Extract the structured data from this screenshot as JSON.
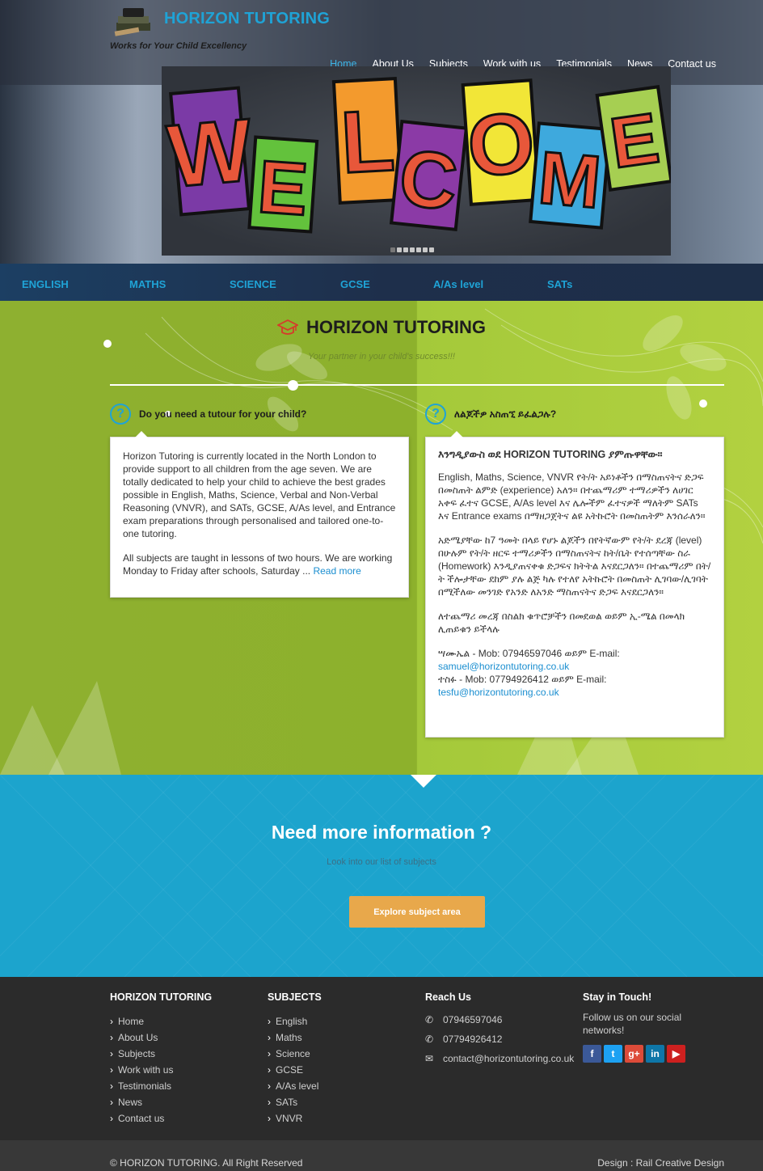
{
  "brand": {
    "name": "HORIZON TUTORING",
    "tagline": "Works for Your Child Excellency"
  },
  "nav": {
    "items": [
      "Home",
      "About Us",
      "Subjects",
      "Work with us",
      "Testimonials",
      "News",
      "Contact us"
    ],
    "active": "Home"
  },
  "slider": {
    "banner_letters": [
      "W",
      "E",
      "L",
      "C",
      "O",
      "M",
      "E"
    ],
    "slide_count": 7
  },
  "subject_bar": [
    "ENGLISH",
    "MATHS",
    "SCIENCE",
    "GCSE",
    "A/As level",
    "SATs"
  ],
  "intro": {
    "title": "HORIZON TUTORING",
    "subtitle": "Your partner in your child's success!!!"
  },
  "left_panel": {
    "question": "Do you need a tutour for your child?",
    "para1": "Horizon Tutoring is currently located in the North London to provide support to all children from the age seven. We are totally dedicated to help your child to achieve the best grades possible in English, Maths, Science, Verbal and Non-Verbal Reasoning (VNVR), and SATs, GCSE, A/As level, and Entrance exam preparations through personalised and tailored one-to-one tutoring.",
    "para2": "All subjects are taught in lessons of two hours. We are working Monday to Friday after schools, Saturday ...",
    "read_more": "Read more"
  },
  "right_panel": {
    "question": "ለልጆችዎ አስጠኚ ይፈልጋሉ?",
    "heading": "እንግዲያውስ ወደ HORIZON TUTORING ያምጡዋቸው።",
    "para1": "English, Maths, Science, VNVR የት/ት አይነቶችን በማስጠናትና ድጋፍ በመስጠት ልምድ (experience) አለን። በተጨማሪም ተማሪዎችን ለሀገር አቀፍ ፈተና GCSE, A/As level እና ሌሎችም ፈተናዎች ማለትም SATs እና Entrance exams በማዘጋጀትና ልዩ አትኩሮት በመስጠትም እንሰራለን።",
    "para2": "አድሜያቸው ከ7 ዓመት በላይ የሆኑ ልጆችን በየትኛውም የት/ት ደረጃ (level) በሁሉም የት/ት ዘርፍ ተማሪዎችን በማስጠናትና ከት/ቤት የተሰጣቸው ስራ (Homework) እንዲያጠናቀቁ ድጋፍና ክትትል እናደርጋለን። በተጨማሪም በት/ት ችሎታቸው ደከም ያሉ ልጅ ካሉ የተለየ አትኩሮት በመስጠት ሊገባው/ሊገባት በሚችለው መንገድ የአንድ ለአንድ ማስጠናትና ድጋፍ እናደርጋለን።",
    "para3": "ለተጨማሪ መረጃ በስልክ ቁጥሮቻችን በመደወል ወይም ኢ-ሜል በመላክ ሊጠይቁን ይችላሉ",
    "contact1_prefix": "ሣሙኤል - Mob: 07946597046 ወይም E-mail:",
    "contact1_email": "samuel@horizontutoring.co.uk",
    "contact2_prefix": "ተስፉ - Mob: 07794926412 ወይም E-mail:",
    "contact2_email": "tesfu@horizontutoring.co.uk"
  },
  "cta": {
    "title": "Need more information ?",
    "subtitle": "Look into our list of subjects",
    "button": "Explore subject area"
  },
  "footer": {
    "col1": {
      "title": "HORIZON TUTORING",
      "links": [
        "Home",
        "About Us",
        "Subjects",
        "Work with us",
        "Testimonials",
        "News",
        "Contact us"
      ]
    },
    "col2": {
      "title": "SUBJECTS",
      "links": [
        "English",
        "Maths",
        "Science",
        "GCSE",
        "A/As level",
        "SATs",
        "VNVR"
      ]
    },
    "col3": {
      "title": "Reach Us",
      "phone1": "07946597046",
      "phone2": "07794926412",
      "email": "contact@horizontutoring.co.uk"
    },
    "col4": {
      "title": "Stay in Touch!",
      "text": "Follow us on our social networks!",
      "social": [
        {
          "icon": "facebook-icon",
          "glyph": "f",
          "color": "#3b5998"
        },
        {
          "icon": "twitter-icon",
          "glyph": "t",
          "color": "#1da1f2"
        },
        {
          "icon": "google-plus-icon",
          "glyph": "g+",
          "color": "#dd4b39"
        },
        {
          "icon": "linkedin-icon",
          "glyph": "in",
          "color": "#0e76a8"
        },
        {
          "icon": "youtube-icon",
          "glyph": "▶",
          "color": "#cd201f"
        }
      ]
    },
    "copyright": "© HORIZON TUTORING. All Right Reserved",
    "design": "Design : Rail Creative Design"
  },
  "colors": {
    "accent_blue": "#1fa3d6",
    "green_left": "#8db12c",
    "green_right": "#b2d140",
    "cta_blue": "#1ca4cd",
    "button_orange": "#e8a84b",
    "footer_bg": "#2b2b2b"
  }
}
